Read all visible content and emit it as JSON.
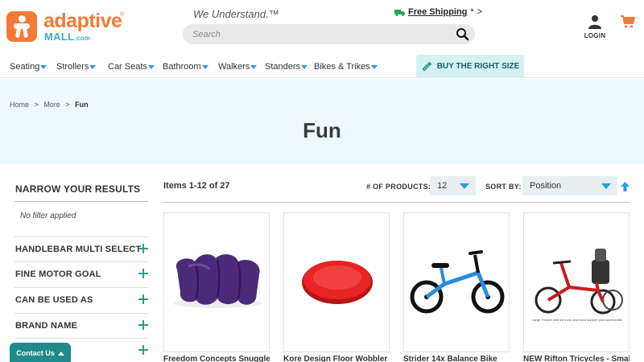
{
  "brand": {
    "name_top": "adaptive",
    "name_bottom": "MALL",
    "domain_suffix": ".com",
    "trademark": "®",
    "tagline": "We Understand.™",
    "brand_orange": "#f47a36",
    "brand_teal": "#3ab0c6"
  },
  "search": {
    "placeholder": "Search",
    "value": ""
  },
  "shipping": {
    "link": "Free Shipping",
    "asterisk": "*",
    "arrow": ">"
  },
  "account": {
    "login_label": "LOGIN"
  },
  "nav": {
    "items": [
      {
        "label": "Seating"
      },
      {
        "label": "Strollers"
      },
      {
        "label": "Car Seats"
      },
      {
        "label": "Bathroom"
      },
      {
        "label": "Walkers"
      },
      {
        "label": "Standers"
      },
      {
        "label": "Bikes & Trikes"
      }
    ],
    "cta_label": "BUY THE RIGHT SIZE"
  },
  "breadcrumb": {
    "items": [
      "Home",
      "More",
      "Fun"
    ],
    "separator": ">"
  },
  "page": {
    "title": "Fun"
  },
  "sidebar": {
    "title": "NARROW YOUR RESULTS",
    "no_filter": "No filter applied",
    "filters": [
      {
        "label": "HANDLEBAR MULTI SELECT"
      },
      {
        "label": "FINE MOTOR GOAL"
      },
      {
        "label": "CAN BE USED AS"
      },
      {
        "label": "BRAND NAME"
      },
      {
        "label": ""
      }
    ]
  },
  "contact": {
    "label": "Contact Us"
  },
  "toolbar": {
    "items_count": "Items 1-12 of 27",
    "per_page_label": "# OF PRODUCTS:",
    "per_page_value": "12",
    "sort_label": "SORT BY:",
    "sort_value": "Position"
  },
  "products": [
    {
      "name": "Freedom Concepts Snuggle",
      "image": "purple-bean-bag-chair"
    },
    {
      "name": "Kore Design Floor Wobbler",
      "image": "red-disc"
    },
    {
      "name": "Strider 14x Balance Bike",
      "image": "blue-balance-bike"
    },
    {
      "name": "NEW Rifton Tricycles - Small",
      "image": "red-adaptive-tricycle"
    }
  ]
}
